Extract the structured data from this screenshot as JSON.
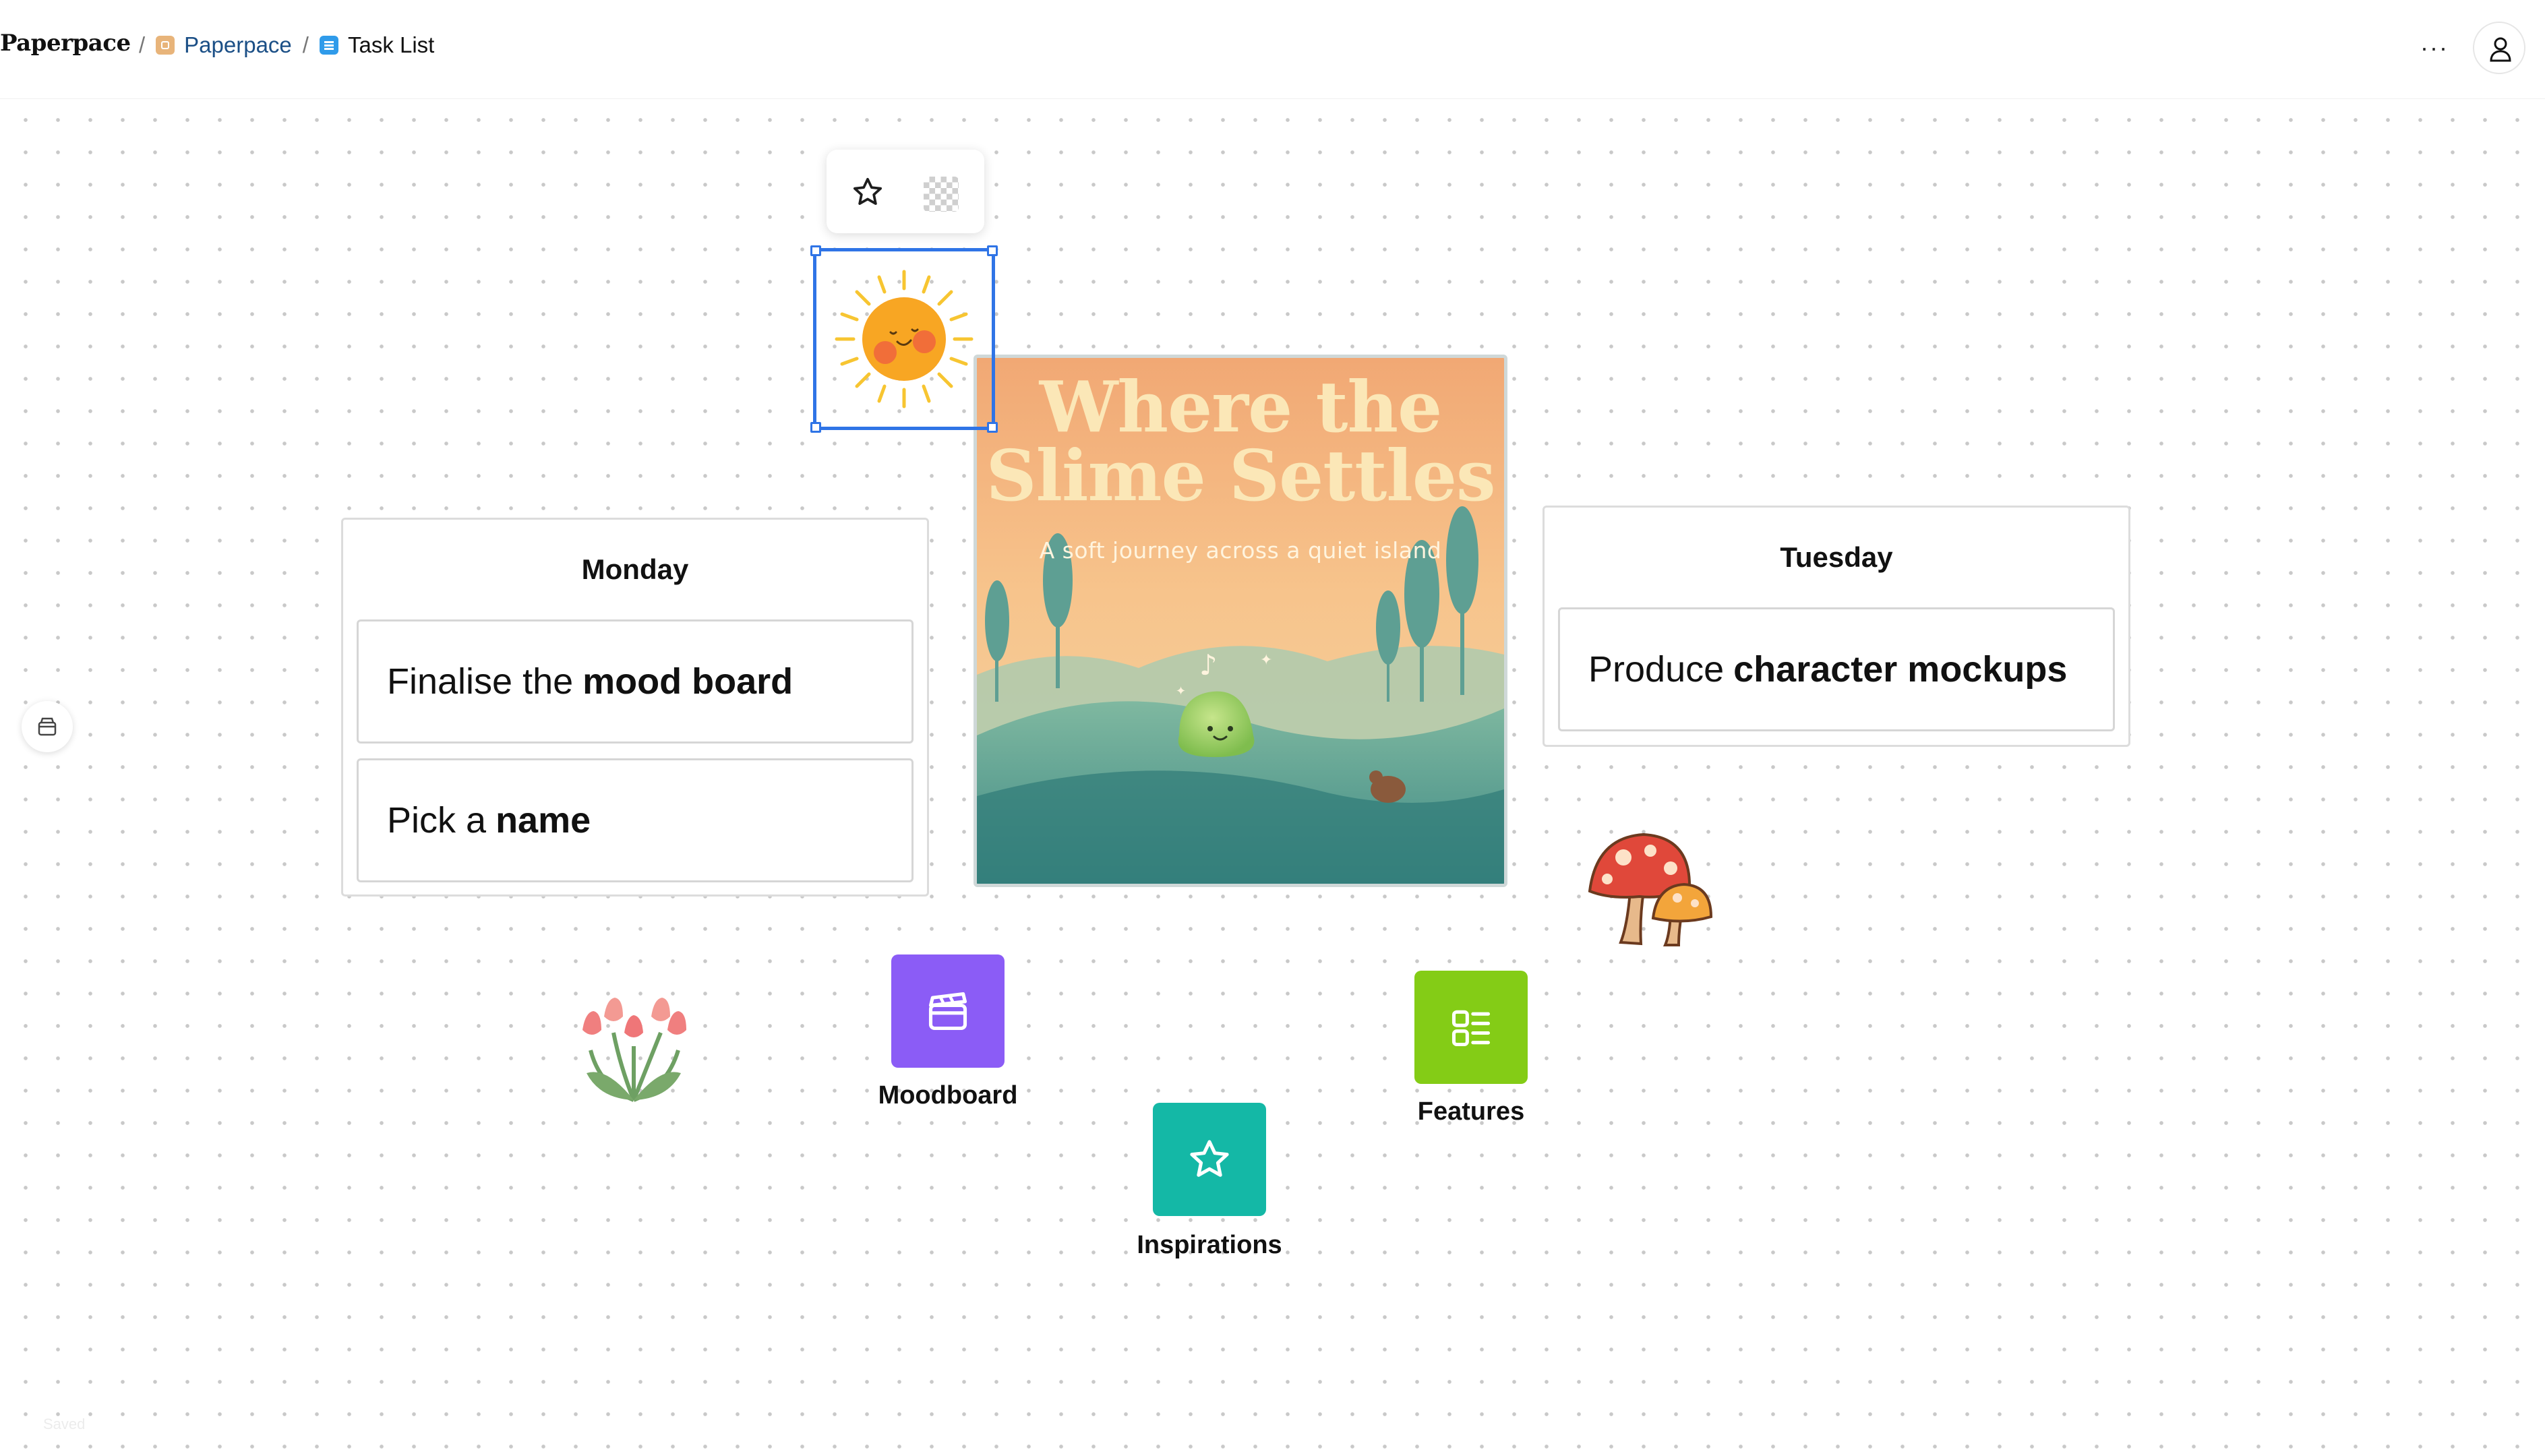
{
  "header": {
    "brand": "Paperpace",
    "breadcrumbs": [
      {
        "label": "Paperpace",
        "icon": "workspace-icon"
      },
      {
        "label": "Task List",
        "icon": "tasklist-icon"
      }
    ],
    "more_label": "···",
    "user_icon": "user-icon"
  },
  "toolbar": {
    "items": [
      "star-icon",
      "transparency-icon"
    ]
  },
  "monday": {
    "title": "Monday",
    "tasks": [
      {
        "text": "Finalise the",
        "bold": "mood board"
      },
      {
        "text": "Pick a",
        "bold": "name"
      }
    ]
  },
  "tuesday": {
    "title": "Tuesday",
    "tasks": [
      {
        "text": "Produce",
        "bold": "character mockups"
      }
    ]
  },
  "cover": {
    "title_line1": "Where the",
    "title_line2": "Slime Settles",
    "subtitle": "A soft journey across a quiet island"
  },
  "apps": [
    {
      "label": "Moodboard",
      "color": "#8b5cf6",
      "icon": "clapperboard-icon"
    },
    {
      "label": "Inspirations",
      "color": "#14b8a6",
      "icon": "star-icon"
    },
    {
      "label": "Features",
      "color": "#84cc16",
      "icon": "list-icon"
    }
  ],
  "status": {
    "saved": "Saved"
  },
  "colors": {
    "selection": "#2f74e6",
    "link": "#1b4f86"
  }
}
